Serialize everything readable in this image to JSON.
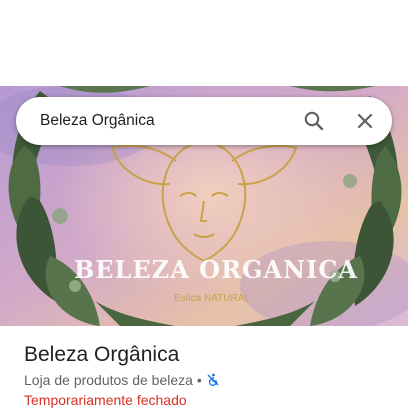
{
  "search": {
    "value": "Beleza Orgânica",
    "search_icon": "search-icon",
    "clear_icon": "close-icon"
  },
  "hero": {
    "logo_title": "BELEZA ORGANICA",
    "logo_subtitle": "Estica NATURAL"
  },
  "place": {
    "name": "Beleza Orgânica",
    "category": "Loja de produtos de beleza",
    "separator": "•",
    "category_icon": "no-wheelchair-icon",
    "status": "Temporariamente fechado"
  },
  "colors": {
    "status_red": "#d93025",
    "accessibility_blue": "#1a73e8",
    "logo_gold": "#c9a24a"
  }
}
